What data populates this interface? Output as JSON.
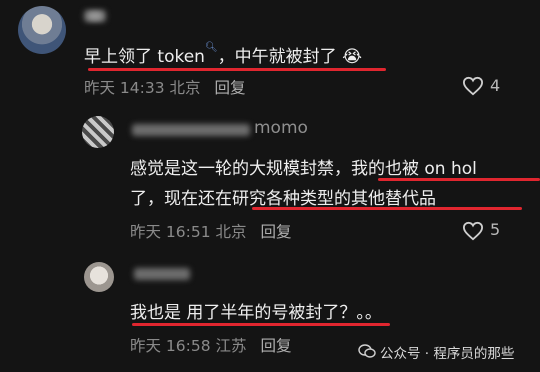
{
  "comments": [
    {
      "text_before": "早上领了 token",
      "text_after": "，中午就被封了",
      "emoji": "😭",
      "time": "昨天 14:33 北京",
      "reply": "回复",
      "likes": "4"
    },
    {
      "username_suffix": "momo",
      "line1": "感觉是这一轮的大规模封禁，我的也被 on hol",
      "line2": "了，现在还在研究各种类型的其他替代品",
      "time": "昨天 16:51 北京",
      "reply": "回复",
      "likes": "5"
    },
    {
      "text": "我也是 用了半年的号被封了？。。",
      "time": "昨天 16:58 江苏",
      "reply": "回复"
    }
  ],
  "watermark": "公众号 · 程序员的那些"
}
